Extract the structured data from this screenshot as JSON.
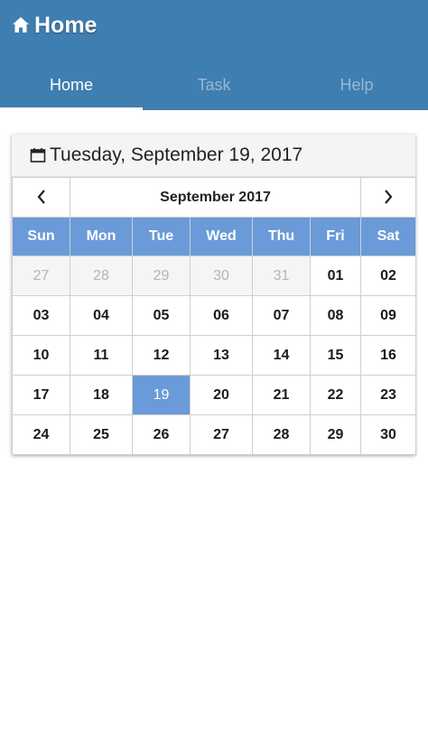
{
  "header": {
    "title": "Home",
    "icon": "home-icon",
    "bg_color": "#3f7eb0"
  },
  "tabs": [
    {
      "label": "Home",
      "active": true
    },
    {
      "label": "Task",
      "active": false
    },
    {
      "label": "Help",
      "active": false
    }
  ],
  "calendar": {
    "header_date": "Tuesday, September 19, 2017",
    "header_icon": "calendar-icon",
    "month_label": "September 2017",
    "accent_color": "#6a9bd8",
    "weekdays": [
      "Sun",
      "Mon",
      "Tue",
      "Wed",
      "Thu",
      "Fri",
      "Sat"
    ],
    "weeks": [
      [
        "27",
        "28",
        "29",
        "30",
        "31",
        "01",
        "02"
      ],
      [
        "03",
        "04",
        "05",
        "06",
        "07",
        "08",
        "09"
      ],
      [
        "10",
        "11",
        "12",
        "13",
        "14",
        "15",
        "16"
      ],
      [
        "17",
        "18",
        "19",
        "20",
        "21",
        "22",
        "23"
      ],
      [
        "24",
        "25",
        "26",
        "27",
        "28",
        "29",
        "30"
      ]
    ],
    "outside_month": [
      "27",
      "28",
      "29",
      "30",
      "31"
    ],
    "selected_day": "19"
  }
}
